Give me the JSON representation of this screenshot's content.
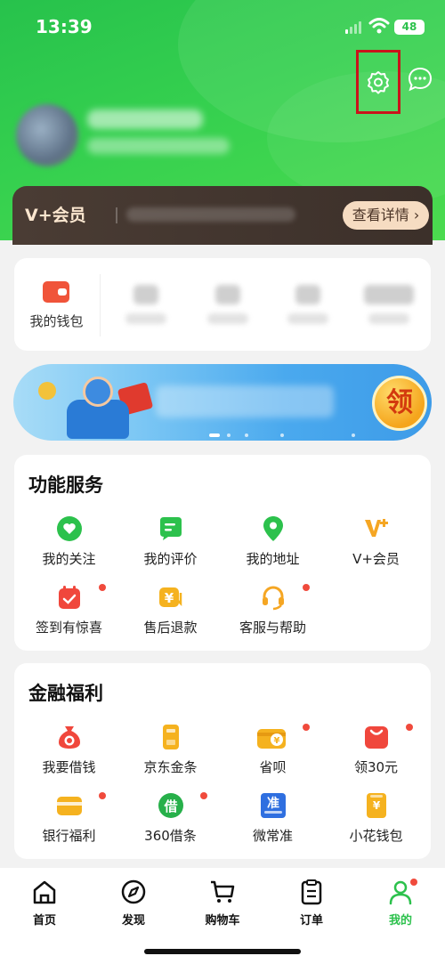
{
  "status_bar": {
    "time": "13:39",
    "battery": "48"
  },
  "vip": {
    "label": "V+会员",
    "detail_button": "查看详情 ›"
  },
  "wallet": {
    "label": "我的钱包"
  },
  "banner": {
    "claim_button": "领"
  },
  "services": {
    "title": "功能服务",
    "items": [
      {
        "label": "我的关注",
        "icon": "heart-icon"
      },
      {
        "label": "我的评价",
        "icon": "comment-icon"
      },
      {
        "label": "我的地址",
        "icon": "location-icon"
      },
      {
        "label": "V+会员",
        "icon": "vplus-icon"
      },
      {
        "label": "签到有惊喜",
        "icon": "calendar-icon"
      },
      {
        "label": "售后退款",
        "icon": "refund-icon"
      },
      {
        "label": "客服与帮助",
        "icon": "headset-icon"
      }
    ]
  },
  "finance": {
    "title": "金融福利",
    "items": [
      {
        "label": "我要借钱",
        "icon": "money-bag-icon"
      },
      {
        "label": "京东金条",
        "icon": "gold-bar-icon"
      },
      {
        "label": "省呗",
        "icon": "wallet-coin-icon"
      },
      {
        "label": "领30元",
        "icon": "red-gift-icon"
      },
      {
        "label": "银行福利",
        "icon": "bank-card-icon"
      },
      {
        "label": "360借条",
        "icon": "borrow-icon"
      },
      {
        "label": "微常准",
        "icon": "zhun-icon"
      },
      {
        "label": "小花钱包",
        "icon": "purse-icon"
      }
    ]
  },
  "tabbar": {
    "items": [
      {
        "label": "首页",
        "icon": "home-icon"
      },
      {
        "label": "发现",
        "icon": "compass-icon"
      },
      {
        "label": "购物车",
        "icon": "cart-icon"
      },
      {
        "label": "订单",
        "icon": "order-icon"
      },
      {
        "label": "我的",
        "icon": "profile-icon"
      }
    ]
  },
  "colors": {
    "brand_green": "#2cc14c",
    "highlight_red": "#c9141b",
    "vip_gold": "#f6dcc2"
  }
}
